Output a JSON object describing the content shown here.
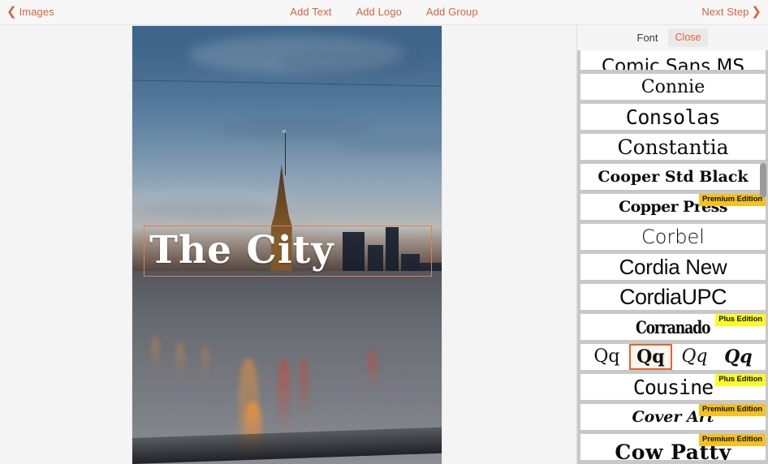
{
  "toolbar": {
    "back_label": "Images",
    "back_icon": "chevron-left-icon",
    "actions": [
      "Add Text",
      "Add Logo",
      "Add Group"
    ],
    "next_label": "Next Step",
    "next_icon": "chevron-right-icon",
    "accent_color": "#d4653c"
  },
  "canvas": {
    "text_object": {
      "content": "The City",
      "selected": true,
      "selection_color": "#e0804c",
      "text_color": "#ffffff"
    },
    "image_description": "night cityscape with wet road, cars and illuminated tower"
  },
  "panel": {
    "title": "Font",
    "close_label": "Close",
    "close_color": "#e0662e",
    "scrollbar": {
      "visible": true,
      "thumb_color": "#9b9b9b"
    },
    "fonts": [
      {
        "name": "Comic Sans MS",
        "class": "f-comic",
        "badge": null,
        "clipped": "top"
      },
      {
        "name": "Connie",
        "class": "f-connie",
        "badge": null
      },
      {
        "name": "Consolas",
        "class": "f-consolas",
        "badge": null
      },
      {
        "name": "Constantia",
        "class": "f-constantia",
        "badge": null
      },
      {
        "name": "Cooper Std Black",
        "class": "f-cooper",
        "badge": null
      },
      {
        "name": "Copper Press",
        "class": "f-copper",
        "badge": "Premium Edition",
        "badge_type": "premium"
      },
      {
        "name": "Corbel",
        "class": "f-corbel",
        "badge": null
      },
      {
        "name": "Cordia New",
        "class": "f-cordia",
        "badge": null
      },
      {
        "name": "CordiaUPC",
        "class": "f-cordiaupc",
        "badge": null
      },
      {
        "name": "Corranado",
        "class": "f-corranado",
        "badge": "Plus Edition",
        "badge_type": "plus"
      }
    ],
    "variants": {
      "label": "font-style-variants",
      "items": [
        {
          "label": "Qq",
          "style": "regular",
          "selected": false
        },
        {
          "label": "Qq",
          "style": "bold",
          "selected": true
        },
        {
          "label": "Qq",
          "style": "italic",
          "selected": false
        },
        {
          "label": "Qq",
          "style": "bold-italic",
          "selected": false
        }
      ],
      "selected_color": "#e0662e"
    },
    "fonts_after": [
      {
        "name": "Cousine",
        "class": "f-cousine",
        "badge": "Plus Edition",
        "badge_type": "plus"
      },
      {
        "name": "Cover Art",
        "class": "f-coverart",
        "badge": "Premium Edition",
        "badge_type": "premium"
      },
      {
        "name": "Cow Patty",
        "class": "f-cowpatty",
        "badge": "Premium Edition",
        "badge_type": "premium",
        "clipped": "bottom"
      }
    ]
  }
}
